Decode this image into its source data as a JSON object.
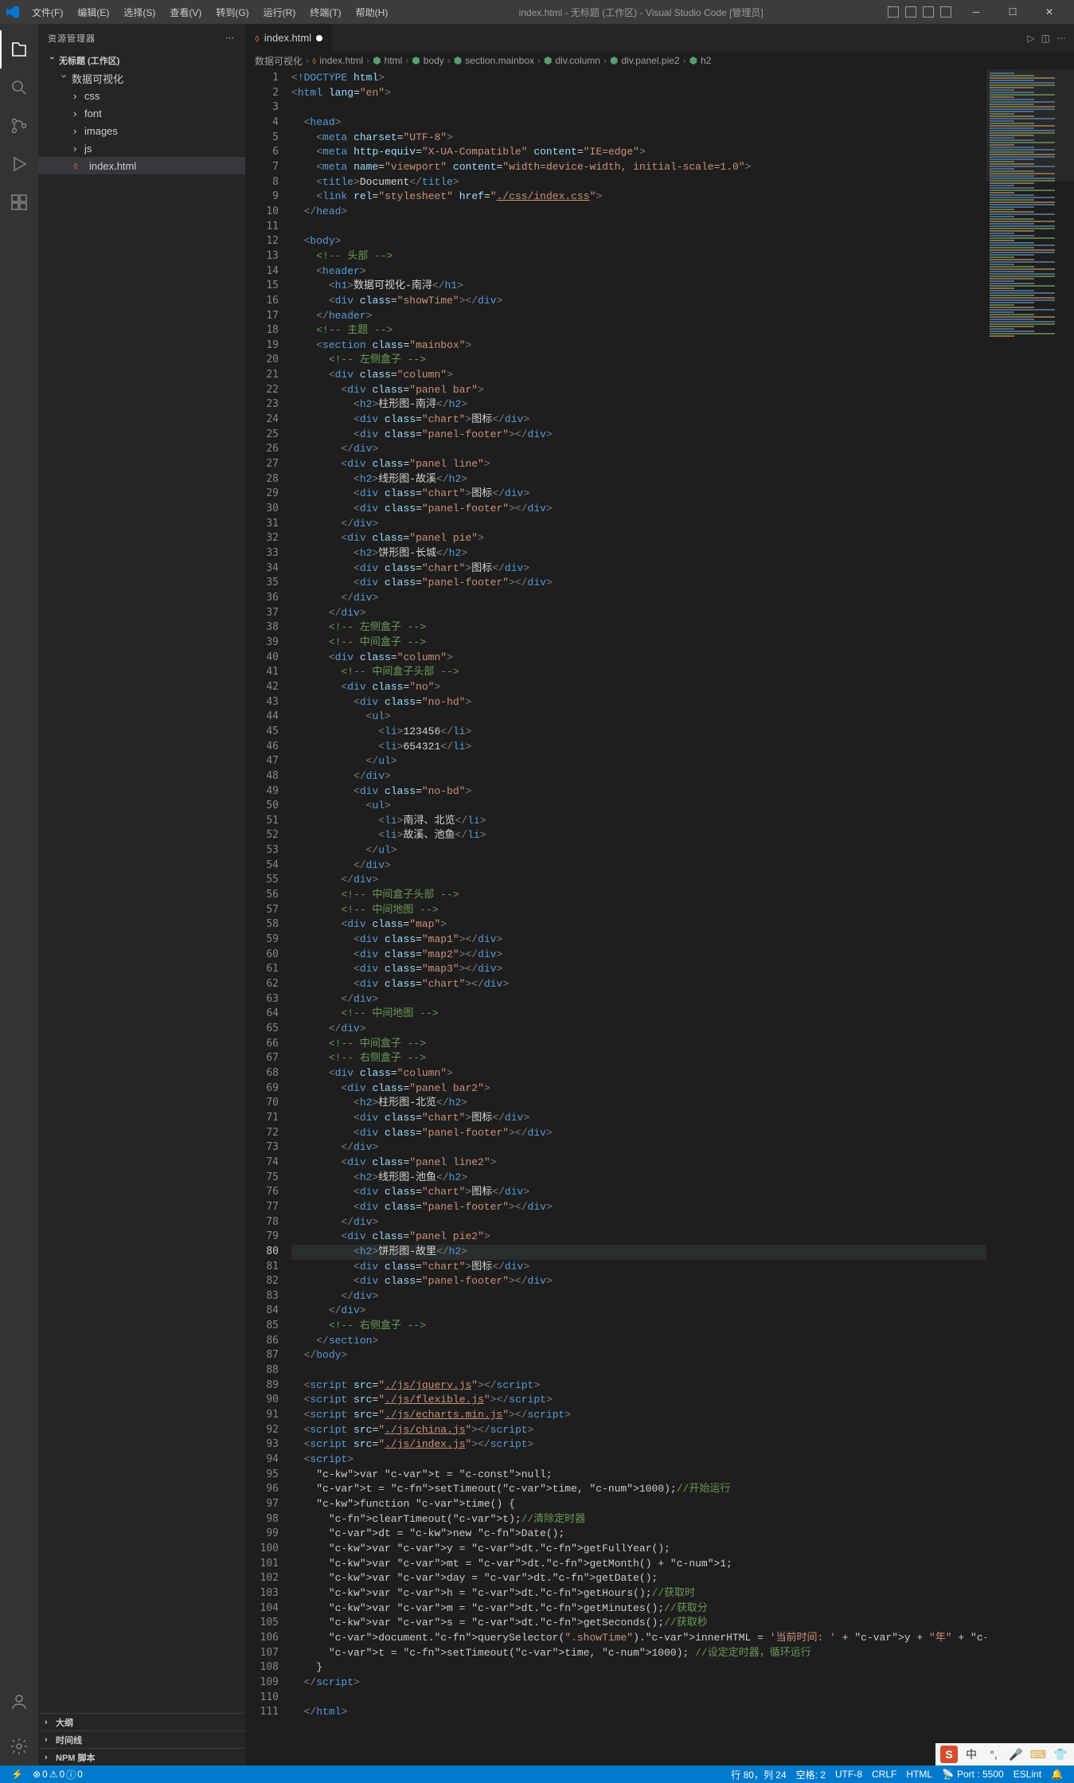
{
  "titlebar": {
    "menu": [
      "文件(F)",
      "编辑(E)",
      "选择(S)",
      "查看(V)",
      "转到(G)",
      "运行(R)",
      "终端(T)",
      "帮助(H)"
    ],
    "title": "index.html - 无标题 (工作区) - Visual Studio Code [管理员]"
  },
  "sidebar": {
    "header": "资源管理器",
    "root": "无标题 (工作区)",
    "project": "数据可视化",
    "folders": [
      "css",
      "font",
      "images",
      "js"
    ],
    "file": "index.html",
    "sections": [
      "大纲",
      "时间线",
      "NPM 脚本"
    ]
  },
  "tabs": {
    "file": "index.html"
  },
  "breadcrumbs": [
    "数据可视化",
    "index.html",
    "html",
    "body",
    "section.mainbox",
    "div.column",
    "div.panel.pie2",
    "h2"
  ],
  "activeLine": 80,
  "code": {
    "l1": {
      "tag": "!DOCTYPE",
      "rest": " html"
    },
    "l2": {
      "tag": "html",
      "attr": "lang",
      "val": "\"en\""
    },
    "l4": {
      "tag": "head"
    },
    "l5": {
      "tag": "meta",
      "attr": "charset",
      "val": "\"UTF-8\""
    },
    "l6": {
      "tag": "meta",
      "a1": "http-equiv",
      "v1": "\"X-UA-Compatible\"",
      "a2": "content",
      "v2": "\"IE=edge\""
    },
    "l7": {
      "tag": "meta",
      "a1": "name",
      "v1": "\"viewport\"",
      "a2": "content",
      "v2": "\"width=device-width, initial-scale=1.0\""
    },
    "l8": {
      "otag": "title",
      "txt": "Document",
      "ctag": "title"
    },
    "l9": {
      "tag": "link",
      "a1": "rel",
      "v1": "\"stylesheet\"",
      "a2": "href",
      "link": "./css/index.css"
    },
    "l10": {
      "ctag": "head"
    },
    "l12": {
      "tag": "body"
    },
    "l13": {
      "cmt": "<!-- 头部 -->"
    },
    "l14": {
      "tag": "header"
    },
    "l15": {
      "otag": "h1",
      "txt": "数据可视化-南浔",
      "ctag": "h1"
    },
    "l16": {
      "otag": "div",
      "attr": "class",
      "val": "\"showTime\"",
      "ctag": "div"
    },
    "l17": {
      "ctag": "header"
    },
    "l18": {
      "cmt": "<!-- 主题 -->"
    },
    "l19": {
      "otag": "section",
      "attr": "class",
      "val": "\"mainbox\""
    },
    "l20": {
      "cmt": "<!-- 左侧盒子 -->"
    },
    "l21": {
      "otag": "div",
      "attr": "class",
      "val": "\"column\""
    },
    "l22": {
      "otag": "div",
      "attr": "class",
      "val": "\"panel bar\""
    },
    "l23": {
      "otag": "h2",
      "txt": "柱形图-南浔",
      "ctag": "h2"
    },
    "l24": {
      "otag": "div",
      "attr": "class",
      "val": "\"chart\"",
      "txt": "图标",
      "ctag": "div"
    },
    "l25": {
      "otag": "div",
      "attr": "class",
      "val": "\"panel-footer\"",
      "ctag": "div"
    },
    "l26": {
      "ctag": "div"
    },
    "l27": {
      "otag": "div",
      "attr": "class",
      "val": "\"panel line\""
    },
    "l28": {
      "otag": "h2",
      "txt": "线形图-故溪",
      "ctag": "h2"
    },
    "l29": {
      "otag": "div",
      "attr": "class",
      "val": "\"chart\"",
      "txt": "图标",
      "ctag": "div"
    },
    "l30": {
      "otag": "div",
      "attr": "class",
      "val": "\"panel-footer\"",
      "ctag": "div"
    },
    "l31": {
      "ctag": "div"
    },
    "l32": {
      "otag": "div",
      "attr": "class",
      "val": "\"panel pie\""
    },
    "l33": {
      "otag": "h2",
      "txt": "饼形图-长城",
      "ctag": "h2"
    },
    "l34": {
      "otag": "div",
      "attr": "class",
      "val": "\"chart\"",
      "txt": "图标",
      "ctag": "div"
    },
    "l35": {
      "otag": "div",
      "attr": "class",
      "val": "\"panel-footer\"",
      "ctag": "div"
    },
    "l36": {
      "ctag": "div"
    },
    "l37": {
      "ctag": "div"
    },
    "l38": {
      "cmt": "<!-- 左侧盒子 -->"
    },
    "l39": {
      "cmt": "<!-- 中间盒子 -->"
    },
    "l40": {
      "otag": "div",
      "attr": "class",
      "val": "\"column\""
    },
    "l41": {
      "cmt": "<!-- 中间盒子头部 -->"
    },
    "l42": {
      "otag": "div",
      "attr": "class",
      "val": "\"no\""
    },
    "l43": {
      "otag": "div",
      "attr": "class",
      "val": "\"no-hd\""
    },
    "l44": {
      "tag": "ul"
    },
    "l45": {
      "otag": "li",
      "txt": "123456",
      "ctag": "li"
    },
    "l46": {
      "otag": "li",
      "txt": "654321",
      "ctag": "li"
    },
    "l47": {
      "ctag": "ul"
    },
    "l48": {
      "ctag": "div"
    },
    "l49": {
      "otag": "div",
      "attr": "class",
      "val": "\"no-bd\""
    },
    "l50": {
      "tag": "ul"
    },
    "l51": {
      "otag": "li",
      "txt": "南浔、北览",
      "ctag": "li"
    },
    "l52": {
      "otag": "li",
      "txt": "故溪、池鱼",
      "ctag": "li"
    },
    "l53": {
      "ctag": "ul"
    },
    "l54": {
      "ctag": "div"
    },
    "l55": {
      "ctag": "div"
    },
    "l56": {
      "cmt": "<!-- 中间盒子头部 -->"
    },
    "l57": {
      "cmt": "<!-- 中间地图 -->"
    },
    "l58": {
      "otag": "div",
      "attr": "class",
      "val": "\"map\""
    },
    "l59": {
      "otag": "div",
      "attr": "class",
      "val": "\"map1\"",
      "ctag": "div"
    },
    "l60": {
      "otag": "div",
      "attr": "class",
      "val": "\"map2\"",
      "ctag": "div"
    },
    "l61": {
      "otag": "div",
      "attr": "class",
      "val": "\"map3\"",
      "ctag": "div"
    },
    "l62": {
      "otag": "div",
      "attr": "class",
      "val": "\"chart\"",
      "ctag": "div"
    },
    "l63": {
      "ctag": "div"
    },
    "l64": {
      "cmt": "<!-- 中间地图 -->"
    },
    "l65": {
      "ctag": "div"
    },
    "l66": {
      "cmt": "<!-- 中间盒子 -->"
    },
    "l67": {
      "cmt": "<!-- 右侧盒子 -->"
    },
    "l68": {
      "otag": "div",
      "attr": "class",
      "val": "\"column\""
    },
    "l69": {
      "otag": "div",
      "attr": "class",
      "val": "\"panel bar2\""
    },
    "l70": {
      "otag": "h2",
      "txt": "柱形图-北览",
      "ctag": "h2"
    },
    "l71": {
      "otag": "div",
      "attr": "class",
      "val": "\"chart\"",
      "txt": "图标",
      "ctag": "div"
    },
    "l72": {
      "otag": "div",
      "attr": "class",
      "val": "\"panel-footer\"",
      "ctag": "div"
    },
    "l73": {
      "ctag": "div"
    },
    "l74": {
      "otag": "div",
      "attr": "class",
      "val": "\"panel line2\""
    },
    "l75": {
      "otag": "h2",
      "txt": "线形图-池鱼",
      "ctag": "h2"
    },
    "l76": {
      "otag": "div",
      "attr": "class",
      "val": "\"chart\"",
      "txt": "图标",
      "ctag": "div"
    },
    "l77": {
      "otag": "div",
      "attr": "class",
      "val": "\"panel-footer\"",
      "ctag": "div"
    },
    "l78": {
      "ctag": "div"
    },
    "l79": {
      "otag": "div",
      "attr": "class",
      "val": "\"panel pie2\""
    },
    "l80": {
      "otag": "h2",
      "txt": "饼形图-故里",
      "ctag": "h2"
    },
    "l81": {
      "otag": "div",
      "attr": "class",
      "val": "\"chart\"",
      "txt": "图标",
      "ctag": "div"
    },
    "l82": {
      "otag": "div",
      "attr": "class",
      "val": "\"panel-footer\"",
      "ctag": "div"
    },
    "l83": {
      "ctag": "div"
    },
    "l84": {
      "ctag": "div"
    },
    "l85": {
      "cmt": "<!-- 右侧盒子 -->"
    },
    "l86": {
      "ctag": "section"
    },
    "l87": {
      "ctag": "body"
    },
    "l89": {
      "otag": "script",
      "attr": "src",
      "link": "./js/jquery.js",
      "ctag": "script"
    },
    "l90": {
      "otag": "script",
      "attr": "src",
      "link": "./js/flexible.js",
      "ctag": "script"
    },
    "l91": {
      "otag": "script",
      "attr": "src",
      "link": "./js/echarts.min.js",
      "ctag": "script"
    },
    "l92": {
      "otag": "script",
      "attr": "src",
      "link": "./js/china.js",
      "ctag": "script"
    },
    "l93": {
      "otag": "script",
      "attr": "src",
      "link": "./js/index.js",
      "ctag": "script"
    },
    "l94": {
      "tag": "script"
    },
    "l95": {
      "js": "var t = null;"
    },
    "l96": {
      "js": "t = setTimeout(time, 1000);",
      "cmt": "//开始运行"
    },
    "l97": {
      "js": "function time() {"
    },
    "l98": {
      "js": "clearTimeout(t);",
      "cmt": "//清除定时器"
    },
    "l99": {
      "js": "dt = new Date();"
    },
    "l100": {
      "js": "var y = dt.getFullYear();"
    },
    "l101": {
      "js": "var mt = dt.getMonth() + 1;"
    },
    "l102": {
      "js": "var day = dt.getDate();"
    },
    "l103": {
      "js": "var h = dt.getHours();",
      "cmt": "//获取时"
    },
    "l104": {
      "js": "var m = dt.getMinutes();",
      "cmt": "//获取分"
    },
    "l105": {
      "js": "var s = dt.getSeconds();",
      "cmt": "//获取秒"
    },
    "l106": {
      "js": "document.querySelector(\".showTime\").innerHTML = '当前时间: ' + y + \"年\" + mt + \"月\" + day + \"-\" + h + \"时\" + m + \"分\" + s"
    },
    "l107": {
      "js": "t = setTimeout(time, 1000);",
      "cmt": " //设定定时器，循环运行"
    },
    "l108": {
      "js": "}"
    },
    "l109": {
      "ctag": "script"
    },
    "l111": {
      "ctag": "html"
    }
  },
  "statusbar": {
    "errors": "0",
    "warnings": "0",
    "info": "0",
    "lineCol": "行 80，列 24",
    "spaces": "空格: 2",
    "encoding": "UTF-8",
    "eol": "CRLF",
    "lang": "HTML",
    "port": "Port : 5500",
    "eslint": "ESLint",
    "bell": "🔔"
  },
  "ime": {
    "s": "S",
    "zh": "中"
  }
}
